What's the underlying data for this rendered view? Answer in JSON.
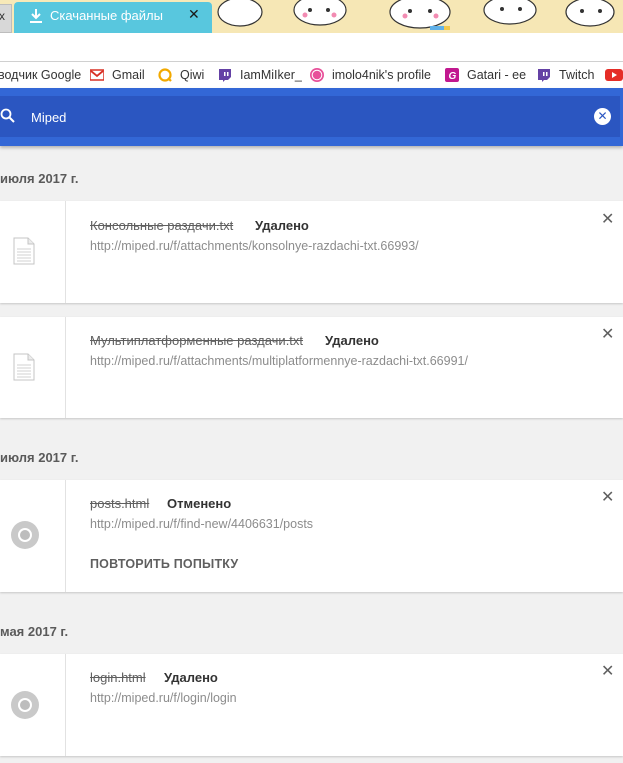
{
  "tab": {
    "prev_close": "x",
    "title": "Скачанные файлы",
    "close": "✕"
  },
  "bookmarks": [
    {
      "label": "водчик Google",
      "icon": "none"
    },
    {
      "label": "Gmail",
      "icon": "gmail-icon",
      "color": "#d93025"
    },
    {
      "label": "Qiwi",
      "icon": "qiwi-icon",
      "color": "#f2a900"
    },
    {
      "label": "IamMiIker_",
      "icon": "twitch-icon",
      "color": "#6441a5"
    },
    {
      "label": "imolo4nik's profile",
      "icon": "osu-icon",
      "color": "#e8509a"
    },
    {
      "label": "Gatari - ee",
      "icon": "gatari-icon",
      "color": "#c1188f"
    },
    {
      "label": "Twitch",
      "icon": "twitch-icon",
      "color": "#6441a5"
    }
  ],
  "search": {
    "value": "Miped",
    "clear": "✕"
  },
  "groups": [
    {
      "date": "июля 2017 г.",
      "items": [
        {
          "file": "Консольные раздачи.txt",
          "status": "Удалено",
          "url": "http://miped.ru/f/attachments/konsolnye-razdachi-txt.66993/",
          "icon": "document-icon"
        },
        {
          "file": "Мультиплатформенные раздачи.txt",
          "status": "Удалено",
          "url": "http://miped.ru/f/attachments/multiplatformennye-razdachi-txt.66991/",
          "icon": "document-icon"
        }
      ]
    },
    {
      "date": "июля 2017 г.",
      "items": [
        {
          "file": "posts.html",
          "status": "Отменено",
          "url": "http://miped.ru/f/find-new/4406631/posts",
          "action": "ПОВТОРИТЬ ПОПЫТКУ",
          "icon": "chrome-icon"
        }
      ]
    },
    {
      "date": "мая 2017 г.",
      "items": [
        {
          "file": "login.html",
          "status": "Удалено",
          "url": "http://miped.ru/f/login/login",
          "icon": "chrome-icon"
        }
      ]
    }
  ],
  "colors": {
    "toolbar": "#3367d6",
    "search_box": "#2b56c1",
    "tab": "#58c7de"
  }
}
